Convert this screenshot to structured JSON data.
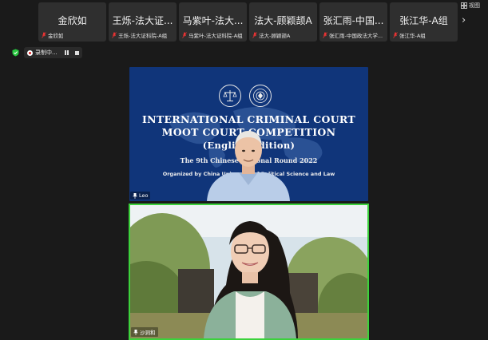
{
  "participants": [
    {
      "big": "金欣如",
      "small": "金欣如"
    },
    {
      "big": "王烁-法大证...",
      "small": "王烁-法大证科院-A组"
    },
    {
      "big": "马紫叶-法大...",
      "small": "马紫叶-法大证科院-A组"
    },
    {
      "big": "法大-顾颖颉A",
      "small": "法大-顾颖颉A"
    },
    {
      "big": "张汇雨-中国...",
      "small": "张汇雨-中国政法大学..."
    },
    {
      "big": "张江华-A组",
      "small": "张江华-A组"
    }
  ],
  "view_label": "视图",
  "recording": {
    "label": "录制中..."
  },
  "slide": {
    "line1": "INTERNATIONAL CRIMINAL COURT",
    "line2": "MOOT COURT COMPETITION",
    "line3": "(English Edition)",
    "line4": "The 9th Chinese National Round 2022",
    "line5": "Organized by China University of Political Science and Law"
  },
  "videos": [
    {
      "name": "Leo"
    },
    {
      "name": "沙洞和"
    }
  ],
  "colors": {
    "active_speaker_border": "#3cd23c",
    "slide_bg": "#10357a",
    "shield": "#28c840"
  }
}
